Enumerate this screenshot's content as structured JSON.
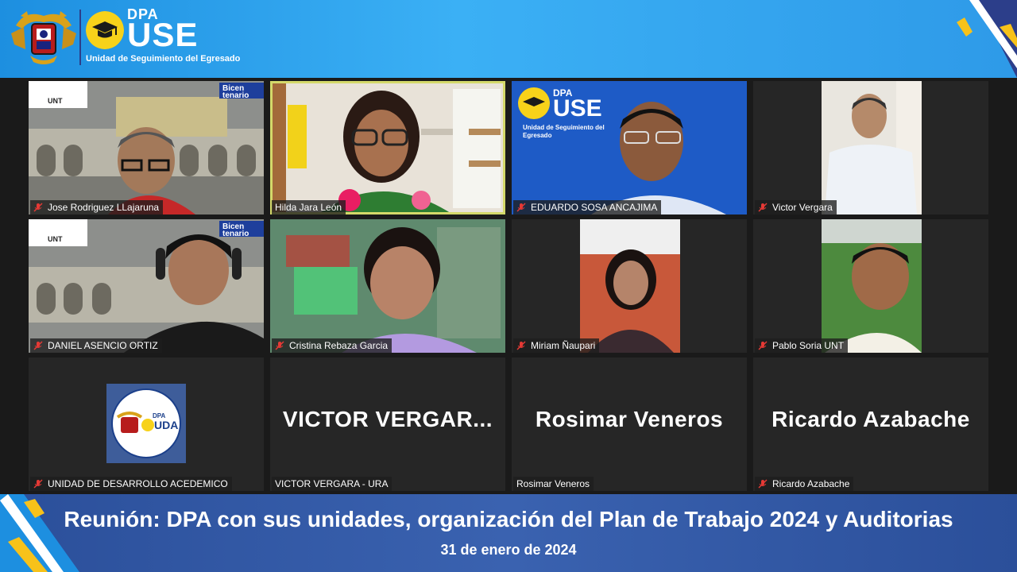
{
  "header": {
    "dpa": "DPA",
    "use": "USE",
    "subtitle": "Unidad de Seguimiento del Egresado"
  },
  "tiles": [
    {
      "name": "Jose Rodriguez LLajaruna",
      "muted": true
    },
    {
      "name": "Hilda  Jara  León",
      "muted": false,
      "active": true
    },
    {
      "name": "EDUARDO SOSA ANCAJIMA",
      "muted": true
    },
    {
      "name": "Victor Vergara",
      "muted": true
    },
    {
      "name": "DANIEL ASENCIO ORTIZ",
      "muted": true
    },
    {
      "name": "Cristina Rebaza Garcia",
      "muted": true
    },
    {
      "name": "Miriam Ñaupari",
      "muted": true
    },
    {
      "name": "Pablo Soria UNT",
      "muted": true
    },
    {
      "name": "UNIDAD DE DESARROLLO ACEDEMICO",
      "muted": true
    },
    {
      "name": "VICTOR VERGARA - URA",
      "muted": false,
      "display": "VICTOR  VERGAR..."
    },
    {
      "name": "Rosimar Veneros",
      "muted": false,
      "display": "Rosimar Veneros"
    },
    {
      "name": "Ricardo Azabache",
      "muted": true,
      "display": "Ricardo Azabache"
    }
  ],
  "tile_labels": {
    "bicentenario": "Bicen tenario",
    "unt": "UNT",
    "uda_dpa": "DPA",
    "uda": "UDA",
    "use_dpa": "DPA",
    "use": "USE",
    "use_sub": "Unidad de Seguimiento del Egresado"
  },
  "footer": {
    "title": "Reunión: DPA con sus unidades, organización del Plan de Trabajo 2024 y Auditorias",
    "date": "31 de enero de 2024"
  },
  "colors": {
    "header_blue": "#2e9ae8",
    "footer_blue": "#3a62b0",
    "accent_yellow": "#f7c21a",
    "active_outline": "#d4d96a",
    "muted_red": "#e53935"
  }
}
